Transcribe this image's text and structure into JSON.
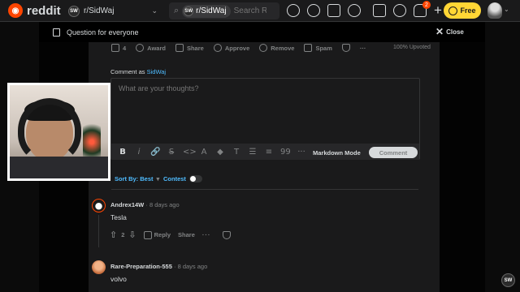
{
  "topbar": {
    "logo_text": "reddit",
    "logo_glyph": "◉",
    "community": "r/SidWaj",
    "community_icon_text": "SW",
    "search": {
      "chip": "r/SidWaj",
      "placeholder": "Search Re"
    },
    "icons": [
      "popular-icon",
      "coins-icon",
      "video-icon",
      "pen-icon",
      "shield-icon",
      "chat-icon",
      "bell-icon",
      "plus-icon"
    ],
    "notification_count": "2",
    "plus": "+",
    "free_button": "Free",
    "brand_color": "#ff4500",
    "accent_color": "#ffd635"
  },
  "modal": {
    "title": "Question for everyone",
    "close_label": "Close",
    "close_glyph": "✕"
  },
  "post_actions": {
    "comment_count": "4",
    "award": "Award",
    "share": "Share",
    "approve": "Approve",
    "remove": "Remove",
    "spam": "Spam",
    "more": "···",
    "upvoted": "100% Upvoted"
  },
  "composer": {
    "comment_as_prefix": "Comment as",
    "username": "SidWaj",
    "placeholder": "What are your thoughts?",
    "tools": [
      "B",
      "i",
      "🔗",
      "S",
      "<>",
      "A",
      "◆",
      "T",
      "☰",
      "≡",
      "99",
      "···"
    ],
    "markdown_mode": "Markdown Mode",
    "comment_button": "Comment"
  },
  "sort": {
    "label": "Sort By: Best",
    "chevron": "▾",
    "contest": "Contest"
  },
  "comments": [
    {
      "author": "Andrex14W",
      "time": "8 days ago",
      "body": "Tesla",
      "votes": "2",
      "reply": "Reply",
      "share": "Share",
      "more": "···"
    },
    {
      "author": "Rare-Preparation-555",
      "time": "8 days ago",
      "body": "volvo"
    }
  ],
  "badge": "SW"
}
